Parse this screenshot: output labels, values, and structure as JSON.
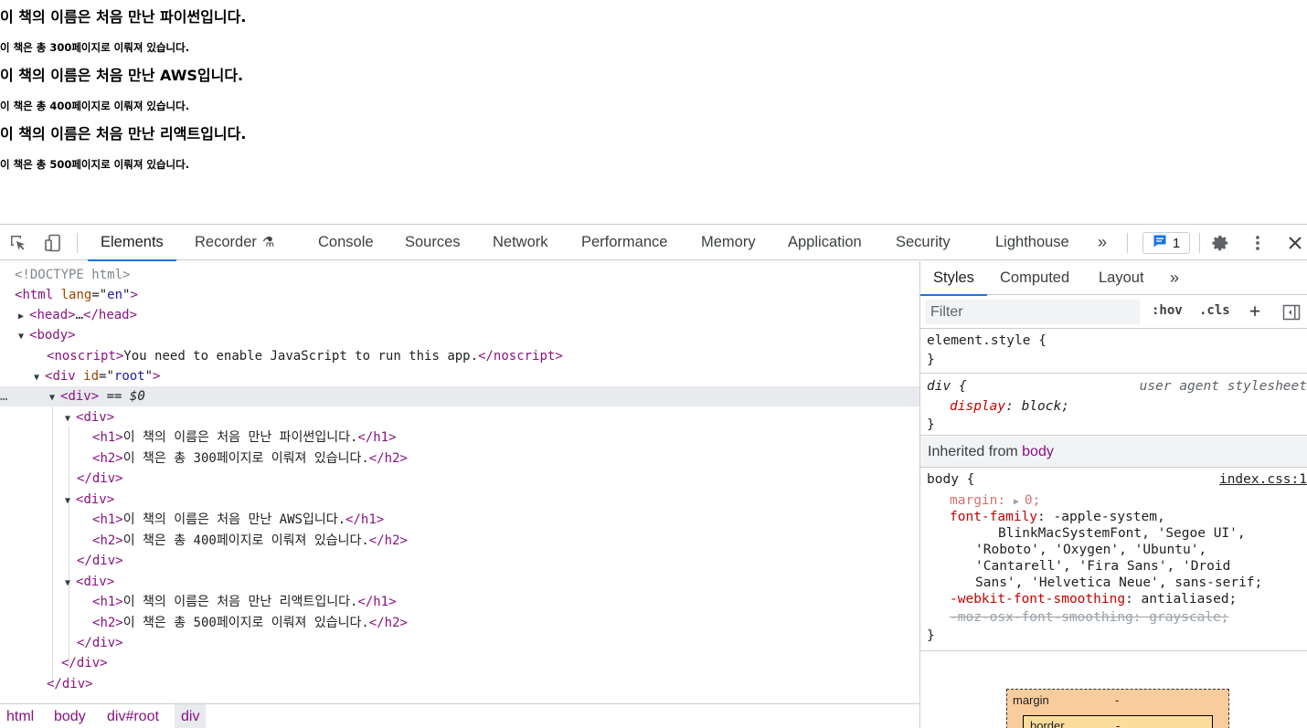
{
  "page": {
    "books": [
      {
        "h1": "이 책의 이름은 처음 만난 파이썬입니다.",
        "h2": "이 책은 총 300페이지로 이뤄져 있습니다."
      },
      {
        "h1": "이 책의 이름은 처음 만난 AWS입니다.",
        "h2": "이 책은 총 400페이지로 이뤄져 있습니다."
      },
      {
        "h1": "이 책의 이름은 처음 만난 리액트입니다.",
        "h2": "이 책은 총 500페이지로 이뤄져 있습니다."
      }
    ]
  },
  "devtools": {
    "tabs": {
      "elements": "Elements",
      "recorder": "Recorder",
      "console": "Console",
      "sources": "Sources",
      "network": "Network",
      "performance": "Performance",
      "memory": "Memory",
      "application": "Application",
      "security": "Security",
      "lighthouse": "Lighthouse",
      "more": "»"
    },
    "issues_count": "1",
    "dom": {
      "doctype": "<!DOCTYPE html>",
      "html_open_tag": "html",
      "html_attr_name": "lang",
      "html_attr_value": "en",
      "head_tag": "head",
      "head_ellipsis": "…",
      "body_tag": "body",
      "noscript_tag": "noscript",
      "noscript_text": "You need to enable JavaScript to run this app.",
      "root_tag": "div",
      "root_attr_name": "id",
      "root_attr_value": "root",
      "div_tag": "div",
      "selected_marker": " == ",
      "selected_var": "$0",
      "h1_tag": "h1",
      "h2_tag": "h2",
      "h1_texts": [
        "이 책의 이름은 처음 만난 파이썬입니다.",
        "이 책의 이름은 처음 만난 AWS입니다.",
        "이 책의 이름은 처음 만난 리액트입니다."
      ],
      "h2_texts": [
        "이 책은 총 300페이지로 이뤄져 있습니다.",
        "이 책은 총 400페이지로 이뤄져 있습니다.",
        "이 책은 총 500페이지로 이뤄져 있습니다."
      ],
      "gutter_dots": "…"
    },
    "breadcrumbs": [
      "html",
      "body",
      "div#root",
      "div"
    ],
    "styles_pane": {
      "tabs": {
        "styles": "Styles",
        "computed": "Computed",
        "layout": "Layout",
        "more": "»"
      },
      "filter_placeholder": "Filter",
      "hov": ":hov",
      "cls": ".cls",
      "plus": "+",
      "element_style_selector": "element.style {",
      "close_brace": "}",
      "ua_rule": {
        "selector": "div {",
        "source": "user agent stylesheet",
        "prop": "display",
        "value": "block;"
      },
      "inherited_label": "Inherited from ",
      "inherited_tag": "body",
      "body_rule": {
        "selector": "body {",
        "source": "index.css:1",
        "margin_prop": "margin",
        "margin_value": "0;",
        "font_family_prop": "font-family",
        "font_family_lines": [
          "-apple-system,",
          "BlinkMacSystemFont, 'Segoe UI',",
          "'Roboto', 'Oxygen', 'Ubuntu',",
          "'Cantarell', 'Fira Sans', 'Droid",
          "Sans', 'Helvetica Neue', sans-serif;"
        ],
        "smoothing_prop": "-webkit-font-smoothing",
        "smoothing_value": "antialiased;",
        "moz_smoothing": "-moz-osx-font-smoothing: grayscale;"
      },
      "box_model": {
        "margin_label": "margin",
        "margin_value": "-",
        "border_label": "border",
        "border_value": "-"
      }
    },
    "colors": {
      "accent": "#1a73e8",
      "tag": "#881280",
      "attr": "#994500",
      "attr_value": "#1a1aa6",
      "css_prop": "#c80000"
    }
  }
}
